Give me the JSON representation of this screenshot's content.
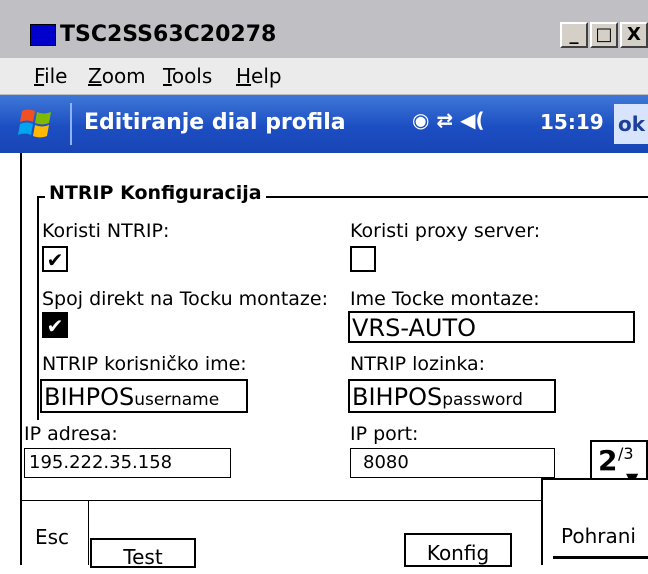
{
  "window": {
    "title": "TSC2SS63C20278",
    "controls": {
      "minimize": "_",
      "maximize": "□",
      "close": "X"
    }
  },
  "menu": {
    "items": [
      {
        "label": "File",
        "ul": "F",
        "rest": "ile"
      },
      {
        "label": "Zoom",
        "ul": "Z",
        "rest": "oom"
      },
      {
        "label": "Tools",
        "ul": "T",
        "rest": "ools"
      },
      {
        "label": "Help",
        "ul": "H",
        "rest": "elp"
      }
    ]
  },
  "taskbar": {
    "title": "Editiranje dial profila",
    "status_icons": "◉ ⇄ ◀(",
    "time": "15:19",
    "ok_label": "ok"
  },
  "form": {
    "group_title": "NTRIP Konfiguracija",
    "use_ntrip": {
      "label": "Koristi NTRIP:",
      "checked": true,
      "mark": "✔"
    },
    "use_proxy": {
      "label": "Koristi proxy server:",
      "checked": false,
      "mark": ""
    },
    "direct_mount": {
      "label": "Spoj direkt na Tocku montaze:",
      "checked": true,
      "mark": "✔"
    },
    "mount_name": {
      "label": "Ime Tocke montaze:",
      "value": "VRS-AUTO"
    },
    "ntrip_user": {
      "label": "NTRIP korisničko ime:",
      "value_main": "BIHPOS",
      "value_sub": "username"
    },
    "ntrip_pass": {
      "label": "NTRIP lozinka:",
      "value_main": "BIHPOS",
      "value_sub": "password"
    },
    "ip_address": {
      "label": "IP adresa:",
      "value": "195.222.35.158"
    },
    "ip_port": {
      "label": "IP port:",
      "value": "8080"
    },
    "page": {
      "current": "2",
      "total": "/3",
      "arrow": "▼"
    }
  },
  "buttons": {
    "esc": "Esc",
    "test": "Test",
    "config": "Konfig",
    "save": "Pohrani"
  }
}
